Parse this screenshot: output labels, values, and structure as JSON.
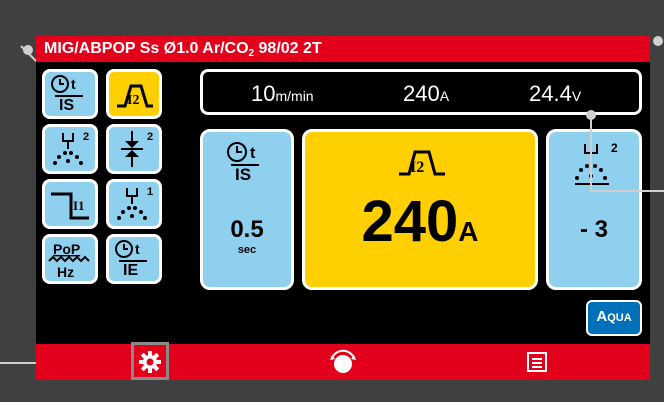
{
  "header": {
    "mode": "MIG/ABPOP",
    "process": "Ss Ø1.0 Ar/CO",
    "gas_sub": "2",
    "mix": "98/02",
    "trigger": "2T"
  },
  "sidebar": {
    "items": [
      {
        "name": "initial-speed",
        "label": "IS"
      },
      {
        "name": "i2-current",
        "label": "I2"
      },
      {
        "name": "pre-gas",
        "label": "2"
      },
      {
        "name": "arc-length",
        "label": "2"
      },
      {
        "name": "i1-current",
        "label": "I1"
      },
      {
        "name": "post-gas",
        "label": "1"
      },
      {
        "name": "pop-frequency",
        "label_top": "PoP",
        "label_bottom": "Hz"
      },
      {
        "name": "end-time",
        "label": "IE"
      }
    ]
  },
  "readout": {
    "wire_speed": "10",
    "wire_unit": "m/min",
    "current": "240",
    "current_unit": "A",
    "voltage": "24.4",
    "voltage_unit": "V"
  },
  "panels": {
    "left": {
      "label": "IS",
      "value": "0.5",
      "unit": "sec"
    },
    "center": {
      "label": "I2",
      "value": "240",
      "unit": "A"
    },
    "right": {
      "label": "2",
      "value": "- 3"
    }
  },
  "aqua": {
    "big": "A",
    "rest": "QUA"
  },
  "colors": {
    "red": "#e2001a",
    "blue": "#8fd0ee",
    "yellow": "#ffcf00",
    "aqua": "#0070b8"
  }
}
